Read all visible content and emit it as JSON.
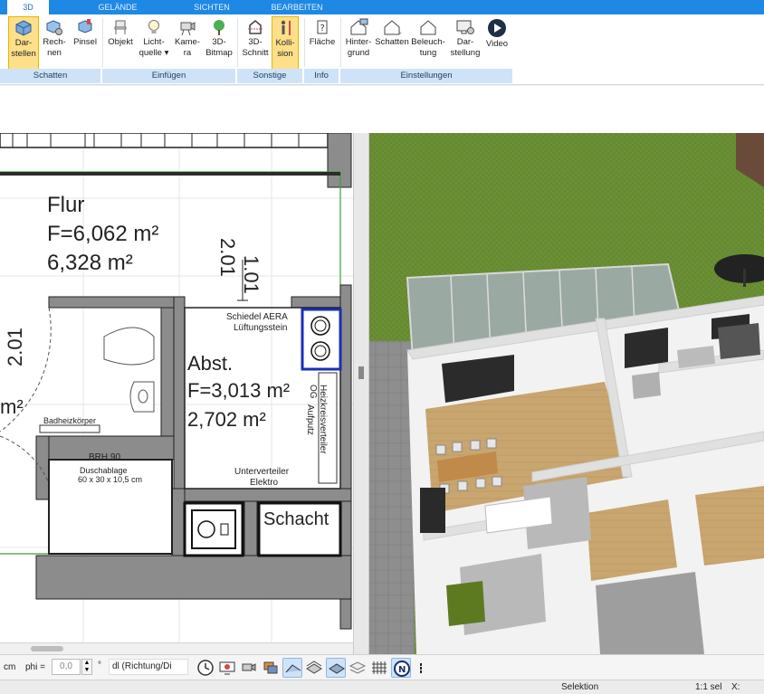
{
  "tabs": [
    {
      "label": "3D",
      "active": true
    },
    {
      "label": "GELÄNDE",
      "active": false
    },
    {
      "label": "SICHTEN",
      "active": false
    },
    {
      "label": "BEARBEITEN",
      "active": false
    }
  ],
  "ribbon": {
    "buttons": [
      {
        "line1": "Dar-",
        "line2": "stellen",
        "icon": "cube-shade-icon",
        "active": true
      },
      {
        "line1": "Rech-",
        "line2": "nen",
        "icon": "cube-gear-icon"
      },
      {
        "line1": "Pinsel",
        "line2": "",
        "icon": "paint-cube-icon"
      },
      {
        "line1": "Objekt",
        "line2": "",
        "icon": "chair-icon"
      },
      {
        "line1": "Licht-",
        "line2": "quelle ▾",
        "icon": "lightbulb-icon"
      },
      {
        "line1": "Kame-",
        "line2": "ra",
        "icon": "camera-icon"
      },
      {
        "line1": "3D-",
        "line2": "Bitmap",
        "icon": "tree-icon"
      },
      {
        "line1": "3D-",
        "line2": "Schnitt",
        "icon": "section-cut-icon"
      },
      {
        "line1": "Kolli-",
        "line2": "sion",
        "icon": "collision-person-icon",
        "active": true
      },
      {
        "line1": "Fläche",
        "line2": "",
        "icon": "area-info-icon"
      },
      {
        "line1": "Hinter-",
        "line2": "grund",
        "icon": "house-background-icon"
      },
      {
        "line1": "Schatten",
        "line2": "",
        "icon": "house-shadow-icon"
      },
      {
        "line1": "Beleuch-",
        "line2": "tung",
        "icon": "house-light-icon"
      },
      {
        "line1": "Dar-",
        "line2": "stellung",
        "icon": "monitor-gear-icon"
      },
      {
        "line1": "Video",
        "line2": "",
        "icon": "play-icon"
      }
    ],
    "groups": [
      "Schatten",
      "Einfügen",
      "Sonstige",
      "Info",
      "Einstellungen"
    ]
  },
  "plan": {
    "flur": {
      "name": "Flur",
      "area1": "F=6,062 m²",
      "area2": "6,328 m²"
    },
    "dim_vertical": "1.01",
    "dim_vertical2": "2.01",
    "dim_left": "2.01",
    "partial_area": "m²",
    "schiedel": {
      "line1": "Schiedel AERA",
      "line2": "Lüftungsstein"
    },
    "abst": {
      "name": "Abst.",
      "area1": "F=3,013 m²",
      "area2": "2,702 m²"
    },
    "heizkreis": {
      "line1": "Heizkreisverteiler OG",
      "line2": "Aufputz"
    },
    "badheizkoerper": "Badheizkörper",
    "brh": "BRH 90",
    "duschablage": {
      "line1": "Duschablage",
      "line2": "60 x 30 x 10,5 cm"
    },
    "unterverteiler": {
      "line1": "Unterverteiler",
      "line2": "Elektro"
    },
    "schacht": "Schacht"
  },
  "bottom": {
    "unit": "cm",
    "phi_label": "phi =",
    "phi_value": "0,0",
    "deg": "°",
    "mode_select": "dl (Richtung/Di"
  },
  "status": {
    "selection": "Selektion",
    "scale": "1:1 sel",
    "x_label": "X:"
  },
  "colors": {
    "accent": "#1e88e5",
    "group": "#cfe3f8",
    "active": "#ffe08a"
  }
}
